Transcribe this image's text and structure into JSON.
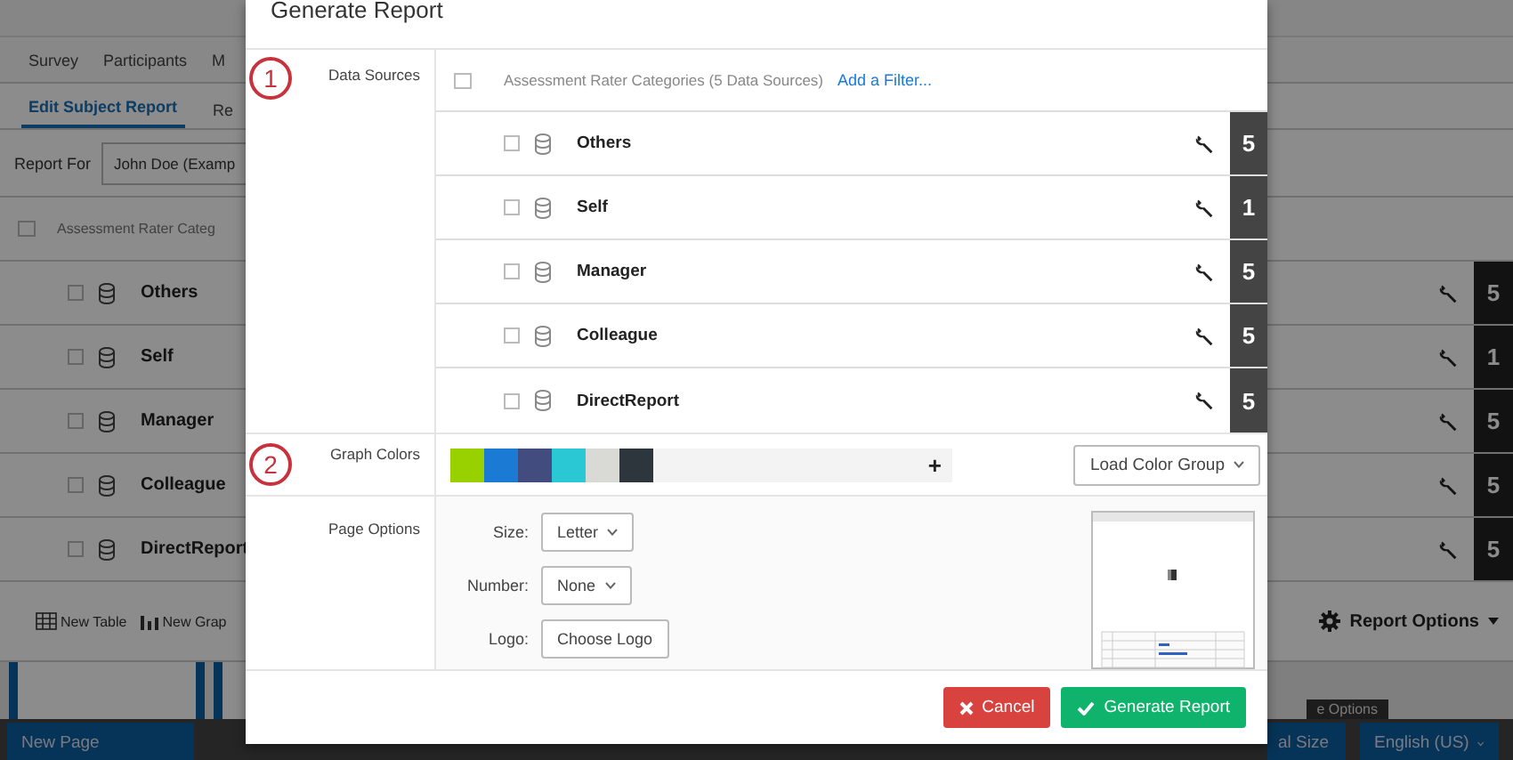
{
  "background": {
    "nav_tabs": [
      {
        "label": "Survey"
      },
      {
        "label": "Participants"
      },
      {
        "label": "M"
      }
    ],
    "sub_tabs": [
      {
        "label": "Edit Subject Report",
        "selected": true
      },
      {
        "label": "Re",
        "selected": false
      }
    ],
    "report_for": {
      "label": "Report For",
      "value": "John Doe (Examp"
    },
    "rater_header": "Assessment Rater Categ",
    "rows": [
      {
        "name": "Others",
        "count": "5"
      },
      {
        "name": "Self",
        "count": "1"
      },
      {
        "name": "Manager",
        "count": "5"
      },
      {
        "name": "Colleague",
        "count": "5"
      },
      {
        "name": "DirectReport",
        "count": "5"
      }
    ],
    "toolbar": {
      "buttons": [
        "New Table",
        "New Grap"
      ],
      "report_options": "Report Options"
    },
    "tooltip": "e Options",
    "footer": {
      "new_page": "New Page",
      "buttons": [
        "al Size",
        "English (US)"
      ]
    }
  },
  "dialog": {
    "title": "Generate Report",
    "data_sources": {
      "step": "1",
      "label": "Data Sources",
      "header": "Assessment Rater Categories (5 Data Sources)",
      "link": "Add a Filter...",
      "sources": [
        {
          "name": "Others",
          "count": "5"
        },
        {
          "name": "Self",
          "count": "1"
        },
        {
          "name": "Manager",
          "count": "5"
        },
        {
          "name": "Colleague",
          "count": "5"
        },
        {
          "name": "DirectReport",
          "count": "5"
        }
      ]
    },
    "graph_colors": {
      "step": "2",
      "label": "Graph Colors",
      "add": "+",
      "load_button": "Load Color Group",
      "swatches": [
        {
          "color": "#99d100"
        },
        {
          "color": "#1a7ad4"
        },
        {
          "color": "#434c7e"
        },
        {
          "color": "#2ac8d4"
        },
        {
          "color": "#d9d9d6"
        },
        {
          "color": "#2e363d"
        }
      ]
    },
    "page_options": {
      "label": "Page Options",
      "fields": [
        {
          "kind": "select",
          "label": "Size:",
          "value": "Letter"
        },
        {
          "kind": "select",
          "label": "Number:",
          "value": "None"
        },
        {
          "kind": "button",
          "label": "Logo:",
          "value": "Choose Logo"
        }
      ]
    },
    "buttons": [
      {
        "kind": "cancel",
        "label": "Cancel"
      },
      {
        "kind": "confirm",
        "label": "Generate Report"
      }
    ]
  }
}
